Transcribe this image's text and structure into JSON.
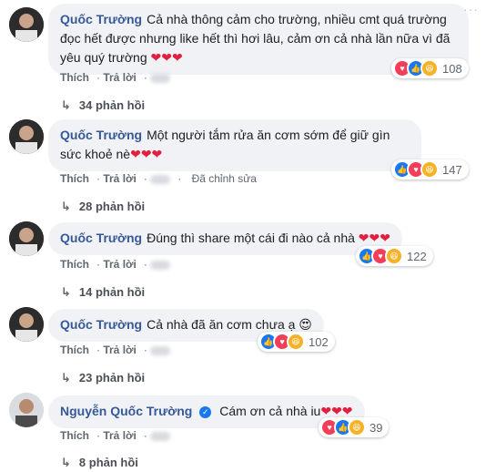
{
  "comments": [
    {
      "name": "Quốc Trường",
      "text": "Cả nhà thông cảm cho trường, nhiều cmt quá trường đọc hết được nhưng like hết thì hơi lâu, cảm ơn cả nhà lần nữa vì đã yêu quý trường",
      "hearts": "❤❤❤",
      "reaction_count": "108",
      "like_label": "Thích",
      "reply_label": "Trả lời",
      "edited_label": "",
      "replies": "34 phản hồi",
      "verified": false
    },
    {
      "name": "Quốc Trường",
      "text": "Một người tắm rửa ăn cơm sớm để giữ gìn sức khoẻ nè",
      "hearts": "❤❤❤",
      "reaction_count": "147",
      "like_label": "Thích",
      "reply_label": "Trả lời",
      "edited_label": "Đã chỉnh sửa",
      "replies": "28 phản hồi",
      "verified": false
    },
    {
      "name": "Quốc Trường",
      "text": "Đúng thì share một cái đi nào cả nhà",
      "hearts": "❤❤❤",
      "reaction_count": "122",
      "like_label": "Thích",
      "reply_label": "Trả lời",
      "edited_label": "",
      "replies": "14 phản hồi",
      "verified": false
    },
    {
      "name": "Quốc Trường",
      "text": "Cả nhà đã ăn cơm chưa ạ",
      "hearts": "😍",
      "reaction_count": "102",
      "like_label": "Thích",
      "reply_label": "Trả lời",
      "edited_label": "",
      "replies": "23 phản hồi",
      "verified": false
    },
    {
      "name": "Nguyễn Quốc Trường",
      "text": "Cám ơn cả nhà iu",
      "hearts": "❤❤❤",
      "reaction_count": "39",
      "like_label": "Thích",
      "reply_label": "Trả lời",
      "edited_label": "",
      "replies": "8 phản hồi",
      "verified": true
    }
  ],
  "icons": {
    "more": "more-options-icon",
    "reply_arrow": "reply-arrow-icon",
    "verified": "verified-badge-icon"
  },
  "colors": {
    "name": "#385898",
    "bubble": "#f0f2f5",
    "like": "#1877f2",
    "love": "#f33e58",
    "haha": "#f7b125"
  }
}
